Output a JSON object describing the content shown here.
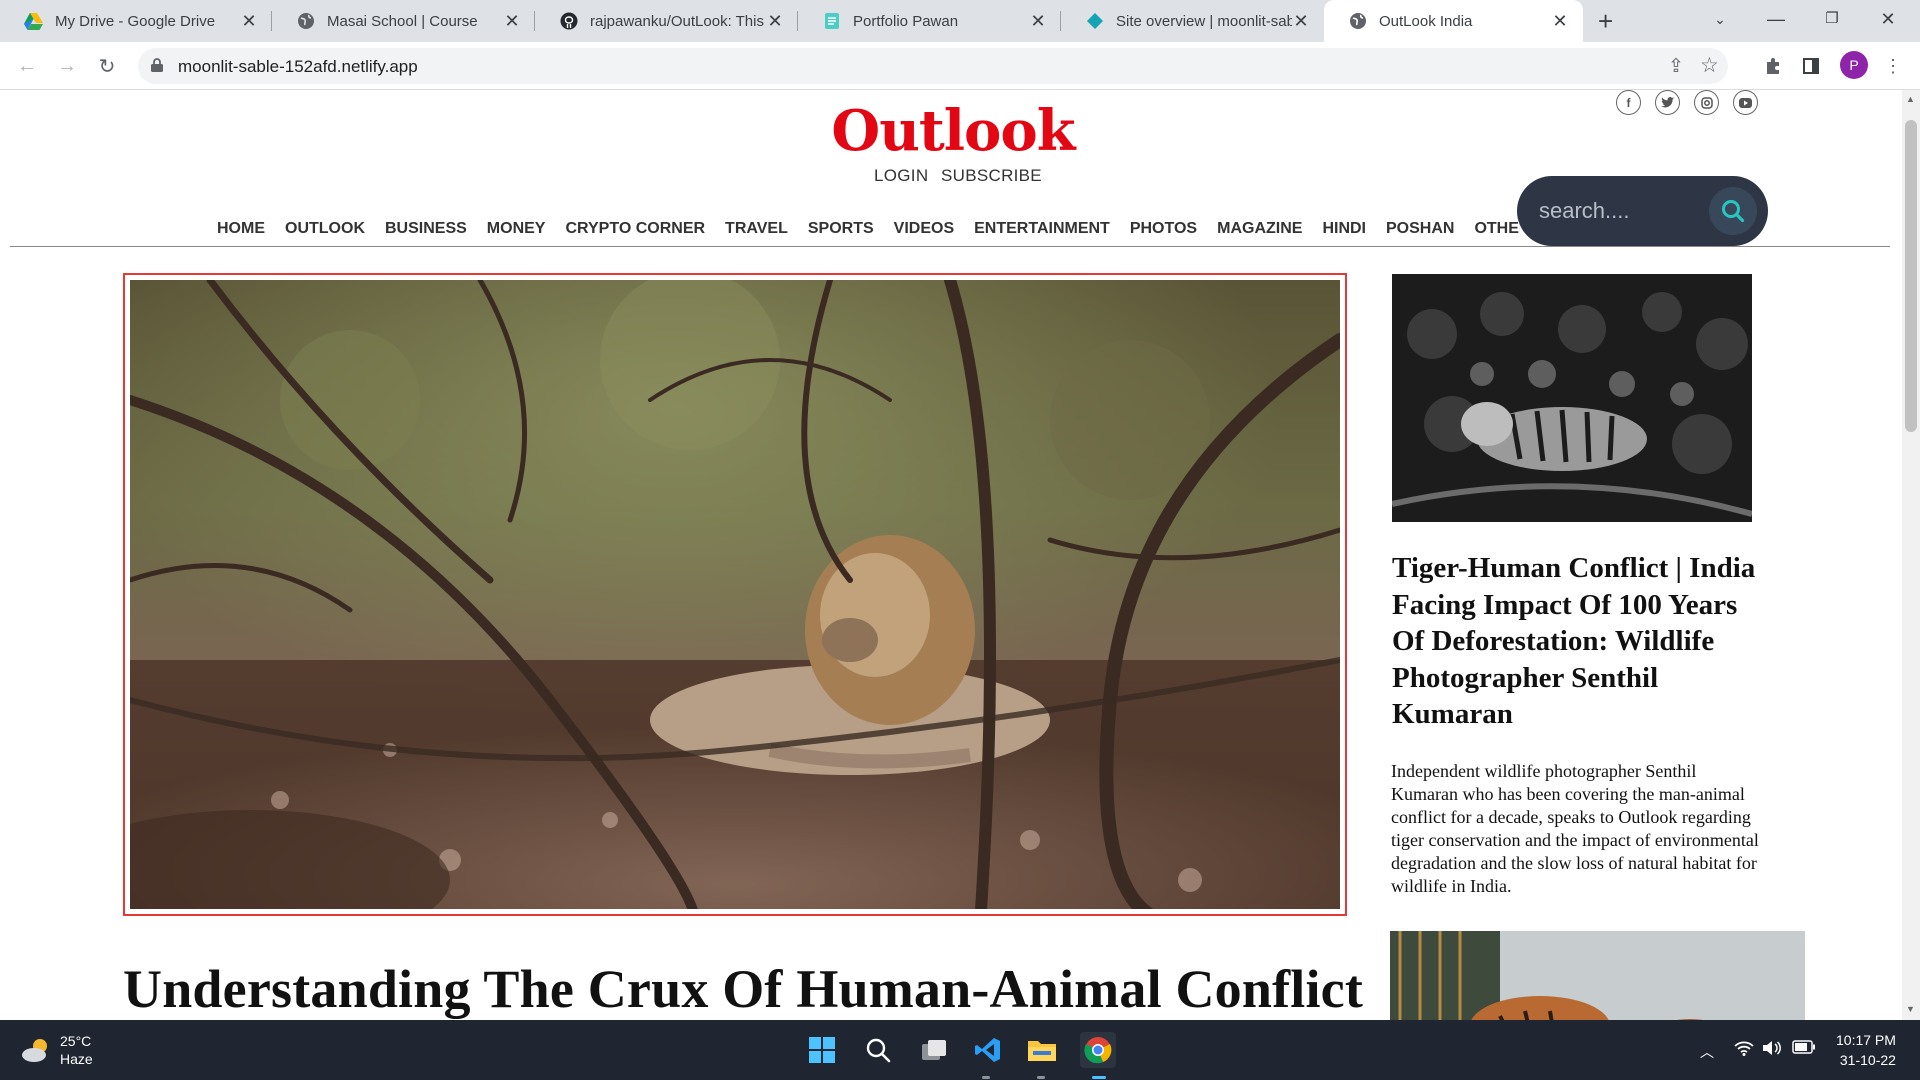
{
  "browser": {
    "tabs": [
      {
        "title": "My Drive - Google Drive",
        "icon": "google-drive-icon"
      },
      {
        "title": "Masai School | Course",
        "icon": "globe-icon"
      },
      {
        "title": "rajpawanku/OutLook: This i",
        "icon": "github-icon"
      },
      {
        "title": "Portfolio Pawan",
        "icon": "document-icon"
      },
      {
        "title": "Site overview | moonlit-sab",
        "icon": "netlify-icon"
      },
      {
        "title": "OutLook India",
        "icon": "globe-icon",
        "active": true
      }
    ],
    "new_tab": "+",
    "url": "moonlit-sable-152afd.netlify.app",
    "profile_initial": "P"
  },
  "site": {
    "logo": "Outlook",
    "login": "LOGIN",
    "subscribe": "SUBSCRIBE",
    "social": [
      "facebook-icon",
      "twitter-icon",
      "instagram-icon",
      "youtube-icon"
    ],
    "nav": [
      "HOME",
      "OUTLOOK",
      "BUSINESS",
      "MONEY",
      "CRYPTO CORNER",
      "TRAVEL",
      "SPORTS",
      "VIDEOS",
      "ENTERTAINMENT",
      "PHOTOS",
      "MAGAZINE",
      "HINDI",
      "POSHAN",
      "OTHERS"
    ],
    "search_placeholder": "search....",
    "colors": {
      "brand_red": "#e30613",
      "search_bg": "#2e3646",
      "search_icon": "#27c7c0"
    }
  },
  "main": {
    "headline": "Understanding The Crux Of Human-Animal Conflict"
  },
  "sidebar": {
    "title": "Tiger-Human Conflict | India Facing Impact Of 100 Years Of Deforestation: Wildlife Photographer Senthil Kumaran",
    "body": "Independent wildlife photographer Senthil Kumaran who has been covering the man-animal conflict for a decade, speaks to Outlook regarding tiger conservation and the impact of environmental degradation and the slow loss of natural habitat for wildlife in India."
  },
  "taskbar": {
    "temperature": "25°C",
    "condition": "Haze",
    "time": "10:17 PM",
    "date": "31-10-22"
  }
}
